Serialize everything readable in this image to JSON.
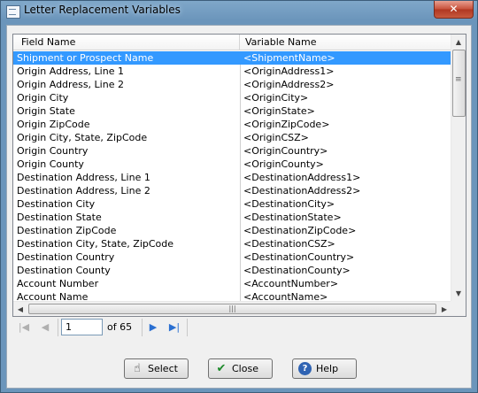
{
  "window": {
    "title": "Letter Replacement Variables",
    "close_glyph": "✕"
  },
  "grid": {
    "headers": [
      "Field Name",
      "Variable Name"
    ],
    "rows": [
      {
        "field": "Shipment or Prospect Name",
        "variable": "<ShipmentName>",
        "selected": true
      },
      {
        "field": "Origin Address, Line 1",
        "variable": "<OriginAddress1>"
      },
      {
        "field": "Origin Address, Line 2",
        "variable": "<OriginAddress2>"
      },
      {
        "field": "Origin City",
        "variable": "<OriginCity>"
      },
      {
        "field": "Origin State",
        "variable": "<OriginState>"
      },
      {
        "field": "Origin ZipCode",
        "variable": "<OriginZipCode>"
      },
      {
        "field": "Origin City, State, ZipCode",
        "variable": "<OriginCSZ>"
      },
      {
        "field": "Origin Country",
        "variable": "<OriginCountry>"
      },
      {
        "field": "Origin County",
        "variable": "<OriginCounty>"
      },
      {
        "field": "Destination Address, Line 1",
        "variable": "<DestinationAddress1>"
      },
      {
        "field": "Destination Address, Line 2",
        "variable": "<DestinationAddress2>"
      },
      {
        "field": "Destination City",
        "variable": "<DestinationCity>"
      },
      {
        "field": "Destination State",
        "variable": "<DestinationState>"
      },
      {
        "field": "Destination ZipCode",
        "variable": "<DestinationZipCode>"
      },
      {
        "field": "Destination City, State, ZipCode",
        "variable": "<DestinationCSZ>"
      },
      {
        "field": "Destination Country",
        "variable": "<DestinationCountry>"
      },
      {
        "field": "Destination County",
        "variable": "<DestinationCounty>"
      },
      {
        "field": "Account Number",
        "variable": "<AccountNumber>"
      },
      {
        "field": "Account Name",
        "variable": "<AccountName>"
      }
    ]
  },
  "navigator": {
    "page_value": "1",
    "page_count_label": "of 65"
  },
  "buttons": {
    "select": "Select",
    "close": "Close",
    "help": "Help"
  },
  "icons": {
    "app": "window-icon",
    "first": "first-page-icon",
    "prev": "previous-page-icon",
    "next": "next-page-icon",
    "last": "last-page-icon",
    "select": "hand-pointer-icon",
    "close": "check-icon",
    "help": "help-icon"
  },
  "colors": {
    "selection": "#3399ff",
    "title_bar": "#6b95bb",
    "close_button": "#c7503a"
  }
}
